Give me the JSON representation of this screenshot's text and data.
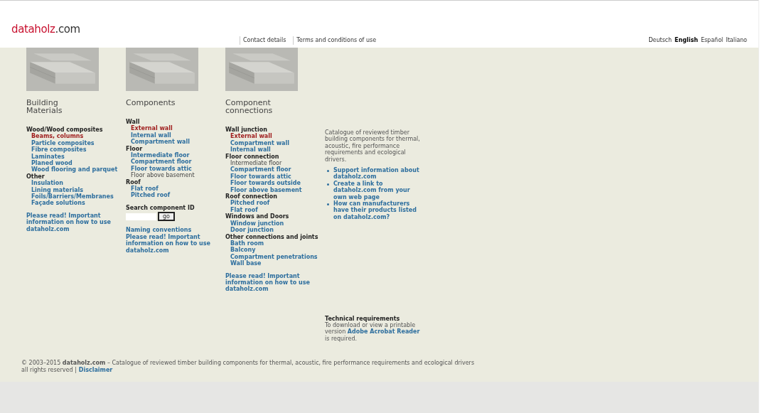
{
  "header": {
    "logo": {
      "brand": "dataholz",
      "suffix": ".com"
    },
    "nav": [
      "Contact details",
      "Terms and conditions of use"
    ],
    "languages": [
      {
        "label": "Deutsch",
        "selected": false
      },
      {
        "label": "English",
        "selected": true
      },
      {
        "label": "Español",
        "selected": false
      },
      {
        "label": "Italiano",
        "selected": false
      }
    ]
  },
  "columns": [
    {
      "kind": "picture",
      "title": "Building Materials",
      "items": [
        {
          "label": "Wood/Wood composites",
          "kind": "heading",
          "children": [
            {
              "label": "Beams, columns",
              "kind": "current"
            },
            {
              "label": "Particle composites",
              "kind": "link"
            },
            {
              "label": "Fibre composites",
              "kind": "link"
            },
            {
              "label": "Laminates",
              "kind": "link"
            },
            {
              "label": "Planed wood",
              "kind": "link"
            },
            {
              "label": "Wood flooring and parquet",
              "kind": "link"
            }
          ]
        },
        {
          "label": "Other",
          "kind": "heading",
          "children": [
            {
              "label": "Insulation",
              "kind": "link"
            },
            {
              "label": "Lining materials",
              "kind": "link"
            },
            {
              "label": "Foils/Barriers/Membranes",
              "kind": "link"
            },
            {
              "label": "Façade solutions",
              "kind": "link"
            }
          ]
        }
      ],
      "links": [
        "Please read! Important information on how to use dataholz.com"
      ]
    },
    {
      "kind": "picture",
      "title": "Components",
      "items": [
        {
          "label": "Wall",
          "kind": "heading",
          "children": [
            {
              "label": "External wall",
              "kind": "current"
            },
            {
              "label": "Internal wall",
              "kind": "link"
            },
            {
              "label": "Compartment wall",
              "kind": "link"
            }
          ]
        },
        {
          "label": "Floor",
          "kind": "heading",
          "children": [
            {
              "label": "Intermediate floor",
              "kind": "link"
            },
            {
              "label": "Compartment floor",
              "kind": "link"
            },
            {
              "label": "Floor towards attic",
              "kind": "link"
            },
            {
              "label": "Floor above basement",
              "kind": "plain"
            }
          ]
        },
        {
          "label": "Roof",
          "kind": "heading",
          "children": [
            {
              "label": "Flat roof",
              "kind": "link"
            },
            {
              "label": "Pitched roof",
              "kind": "link"
            }
          ]
        }
      ],
      "search": {
        "label": "Search component ID",
        "button": "go"
      },
      "links": [
        "Naming conventions",
        "Please read! Important information on how to use dataholz.com"
      ]
    },
    {
      "kind": "picture",
      "title": "Component connections",
      "items": [
        {
          "label": "Wall junction",
          "kind": "heading",
          "children": [
            {
              "label": "External wall",
              "kind": "current"
            },
            {
              "label": "Compartment wall",
              "kind": "link"
            },
            {
              "label": "Internal wall",
              "kind": "link"
            }
          ]
        },
        {
          "label": "Floor connection",
          "kind": "heading",
          "children": [
            {
              "label": "Intermediate floor",
              "kind": "plain"
            },
            {
              "label": "Compartment floor",
              "kind": "link"
            },
            {
              "label": "Floor towards attic",
              "kind": "link"
            },
            {
              "label": "Floor towards outside",
              "kind": "link"
            },
            {
              "label": "Floor above basement",
              "kind": "link"
            }
          ]
        },
        {
          "label": "Roof connection",
          "kind": "heading",
          "children": [
            {
              "label": "Pitched roof",
              "kind": "link"
            },
            {
              "label": "Flat roof",
              "kind": "link"
            }
          ]
        },
        {
          "label": "Windows and Doors",
          "kind": "heading",
          "children": [
            {
              "label": "Window junction",
              "kind": "link"
            },
            {
              "label": "Door junction",
              "kind": "link"
            }
          ]
        },
        {
          "label": "Other connections and joints",
          "kind": "heading",
          "children": [
            {
              "label": "Bath room",
              "kind": "link"
            },
            {
              "label": "Balcony",
              "kind": "link"
            },
            {
              "label": "Compartment penetrations",
              "kind": "link"
            },
            {
              "label": "Wall base",
              "kind": "link"
            }
          ]
        }
      ],
      "links": [
        "Please read! Important information on how to use dataholz.com"
      ]
    }
  ],
  "info": {
    "intro": "Catalogue of reviewed timber building components for thermal, acoustic, fire performance requirements and ecological drivers.",
    "bullets": [
      "Support information about dataholz.com",
      "Create a link to dataholz.com from your own web page",
      "How can manufacturers have their products listed on dataholz.com?"
    ],
    "tech_title": "Technical requirements",
    "tech_before": "To download or view a printable version",
    "tech_link": "Adobe Acrobat Reader",
    "tech_after": "is required."
  },
  "footer": {
    "copyright": "© 2003–2015 **dataholz.com** – Catalogue of reviewed timber building components for thermal, acoustic, fire performance requirements and ecological drivers",
    "rights": "all rights reserved |",
    "disclaimer": "Disclaimer"
  }
}
